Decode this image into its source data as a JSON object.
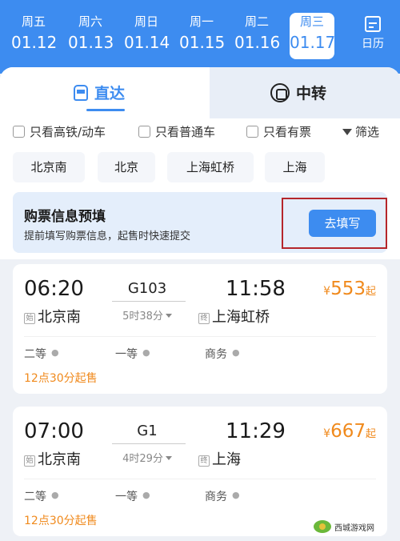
{
  "date_strip": {
    "days": [
      {
        "weekday": "周五",
        "date": "01.12"
      },
      {
        "weekday": "周六",
        "date": "01.13"
      },
      {
        "weekday": "周日",
        "date": "01.14"
      },
      {
        "weekday": "周一",
        "date": "01.15"
      },
      {
        "weekday": "周二",
        "date": "01.16"
      },
      {
        "weekday": "周三",
        "date": "01.17"
      }
    ],
    "selected_date": "01.17",
    "calendar_label": "日历"
  },
  "tabs": {
    "direct": "直达",
    "transfer": "中转",
    "active": "直达"
  },
  "filters": {
    "high_speed": "只看高铁/动车",
    "regular": "只看普通车",
    "available": "只看有票",
    "filter": "筛选"
  },
  "stations": [
    "北京南",
    "北京",
    "上海虹桥",
    "上海"
  ],
  "prefill": {
    "title": "购票信息预填",
    "desc": "提前填写购票信息，起售时快速提交",
    "button": "去填写"
  },
  "trains": [
    {
      "dep_time": "06:20",
      "train_no": "G103",
      "arr_time": "11:58",
      "duration": "5时38分",
      "dep_station_tag": "始",
      "dep_station": "北京南",
      "arr_station_tag": "终",
      "arr_station": "上海虹桥",
      "price_symbol": "¥",
      "price": "553",
      "price_suffix": "起",
      "seats": [
        "二等",
        "一等",
        "商务"
      ],
      "sale_time": "12点30分起售"
    },
    {
      "dep_time": "07:00",
      "train_no": "G1",
      "arr_time": "11:29",
      "duration": "4时29分",
      "dep_station_tag": "始",
      "dep_station": "北京南",
      "arr_station_tag": "终",
      "arr_station": "上海",
      "price_symbol": "¥",
      "price": "667",
      "price_suffix": "起",
      "seats": [
        "二等",
        "一等",
        "商务"
      ],
      "sale_time": "12点30分起售"
    }
  ],
  "watermark": "西城游戏网",
  "colors": {
    "primary": "#3d8cf0",
    "price": "#f08a1d",
    "highlight_box": "#b5262b"
  }
}
